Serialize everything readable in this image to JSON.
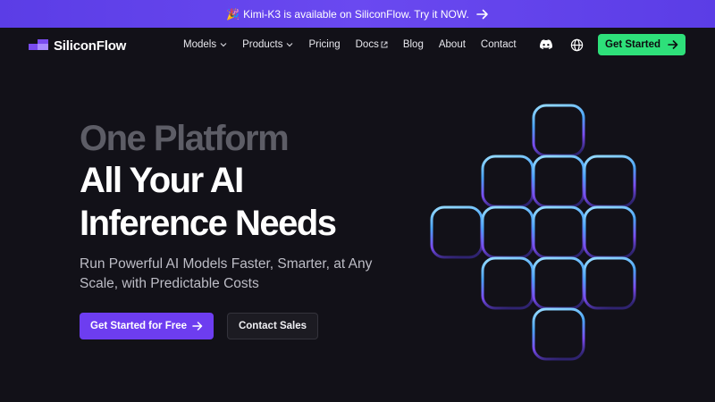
{
  "banner": {
    "emoji": "🎉",
    "text": "Kimi-K3 is available on SiliconFlow. Try it NOW.",
    "arrow_icon": "arrow-right-icon"
  },
  "brand": {
    "name": "SiliconFlow",
    "logo_icon": "siliconflow-logo-icon"
  },
  "nav": {
    "items": [
      {
        "label": "Models",
        "icon": "chevron-down-icon"
      },
      {
        "label": "Products",
        "icon": "chevron-down-icon"
      },
      {
        "label": "Pricing"
      },
      {
        "label": "Docs",
        "icon": "external-link-icon"
      },
      {
        "label": "Blog"
      },
      {
        "label": "About"
      },
      {
        "label": "Contact"
      }
    ],
    "discord_icon": "discord-icon",
    "language_icon": "globe-icon",
    "cta_label": "Get Started"
  },
  "hero": {
    "line1": "One Platform",
    "line2": "All Your AI",
    "line3": "Inference Needs",
    "subtitle": "Run Powerful AI Models Faster, Smarter, at Any Scale,  with Predictable Costs",
    "primary_button": "Get Started for Free",
    "secondary_button": "Contact Sales"
  },
  "colors": {
    "background": "#121118",
    "banner": "#6147ec",
    "cta_green": "#2ee07a",
    "primary_purple": "#6d3df0",
    "graphic_gradient": [
      "#8fd6ff",
      "#4aa3f5",
      "#7a4cf0",
      "#3a2a8a"
    ]
  }
}
